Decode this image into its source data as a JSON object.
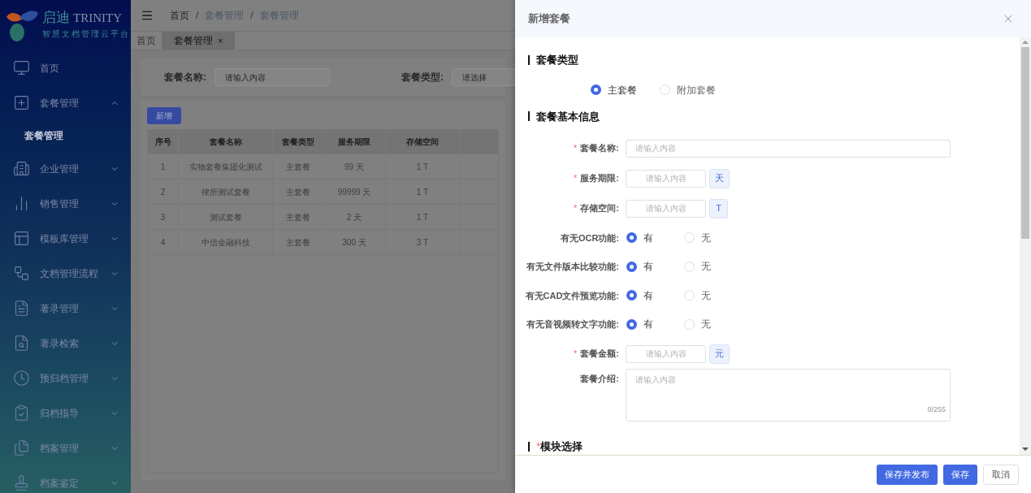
{
  "sidebar": {
    "logo": {
      "name": "启迪",
      "brand": "TRINITY",
      "subtitle": "智慧文档管理云平台"
    },
    "items": [
      {
        "label": "首页"
      },
      {
        "label": "套餐管理",
        "expanded": true,
        "children": [
          {
            "label": "套餐管理",
            "selected": true
          }
        ]
      },
      {
        "label": "企业管理",
        "expanded": false
      },
      {
        "label": "销售管理",
        "expanded": false
      },
      {
        "label": "模板库管理",
        "expanded": false
      },
      {
        "label": "文档管理流程",
        "expanded": false
      },
      {
        "label": "著录管理",
        "expanded": false
      },
      {
        "label": "著录检索",
        "expanded": false
      },
      {
        "label": "预归档管理",
        "expanded": false
      },
      {
        "label": "归档指导",
        "expanded": false
      },
      {
        "label": "档案管理",
        "expanded": false
      },
      {
        "label": "档案鉴定",
        "expanded": false
      }
    ]
  },
  "breadcrumb": {
    "items": [
      "首页",
      "套餐管理",
      "套餐管理"
    ],
    "separator": "/"
  },
  "tabs": [
    {
      "label": "首页",
      "selected": false
    },
    {
      "label": "套餐管理",
      "selected": true,
      "close": "×"
    }
  ],
  "filter": [
    {
      "label": "套餐名称:",
      "placeholder": "请输入内容",
      "kind": "input"
    },
    {
      "label": "套餐类型:",
      "placeholder": "请选择",
      "kind": "select"
    }
  ],
  "add_button": "新增",
  "table": {
    "columns": [
      "序号",
      "套餐名称",
      "套餐类型",
      "服务期限",
      "存储空间"
    ],
    "rows": [
      [
        "1",
        "实物套餐集团化测试",
        "主套餐",
        "99 天",
        "1 T"
      ],
      [
        "2",
        "律所测试套餐",
        "主套餐",
        "99999 天",
        "1 T"
      ],
      [
        "3",
        "测试套餐",
        "主套餐",
        "2 天",
        "1 T"
      ],
      [
        "4",
        "中信金融科技",
        "主套餐",
        "300 天",
        "3 T"
      ]
    ]
  },
  "drawer": {
    "title": "新增套餐",
    "type_section": {
      "title": "套餐类型",
      "options": [
        {
          "label": "主套餐",
          "selected": true
        },
        {
          "label": "附加套餐",
          "selected": false
        }
      ]
    },
    "info_section": {
      "title": "套餐基本信息",
      "fields": [
        {
          "kind": "text",
          "mark": "*",
          "label": "套餐名称:",
          "placeholder": "请输入内容"
        },
        {
          "kind": "unit",
          "mark": "*",
          "label": "服务期限:",
          "placeholder": "请输入内容",
          "unit": "天"
        },
        {
          "kind": "unit",
          "mark": "*",
          "label": "存储空间:",
          "placeholder": "请输入内容",
          "unit": "T"
        },
        {
          "kind": "radio",
          "label": "有无OCR功能:",
          "options": [
            {
              "label": "有",
              "selected": true
            },
            {
              "label": "无",
              "selected": false
            }
          ]
        },
        {
          "kind": "radio",
          "label": "有无文件版本比较功能:",
          "options": [
            {
              "label": "有",
              "selected": true
            },
            {
              "label": "无",
              "selected": false
            }
          ]
        },
        {
          "kind": "radio",
          "label": "有无CAD文件预览功能:",
          "options": [
            {
              "label": "有",
              "selected": true
            },
            {
              "label": "无",
              "selected": false
            }
          ]
        },
        {
          "kind": "radio",
          "label": "有无音视频转文字功能:",
          "options": [
            {
              "label": "有",
              "selected": true
            },
            {
              "label": "无",
              "selected": false
            }
          ]
        },
        {
          "kind": "unit",
          "mark": "*",
          "label": "套餐金额:",
          "placeholder": "请输入内容",
          "unit": "元"
        },
        {
          "kind": "textarea",
          "label": "套餐介绍:",
          "placeholder": "请输入内容",
          "counter": "0/255"
        }
      ]
    },
    "module_section": {
      "title": "模块选择",
      "mark": "*"
    },
    "buttons": [
      {
        "label": "保存并发布",
        "kind": "primary"
      },
      {
        "label": "保存",
        "kind": "primary"
      },
      {
        "label": "取消",
        "kind": "default"
      }
    ]
  }
}
